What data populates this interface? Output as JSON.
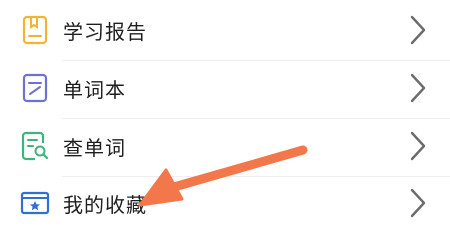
{
  "menu": {
    "items": [
      {
        "label": "学习报告",
        "icon": "report-icon",
        "color": "#f2b531"
      },
      {
        "label": "单词本",
        "icon": "wordbook-icon",
        "color": "#6f70d6"
      },
      {
        "label": "查单词",
        "icon": "search-word-icon",
        "color": "#3fb37a"
      },
      {
        "label": "我的收藏",
        "icon": "favorites-icon",
        "color": "#2f6fd6"
      }
    ],
    "chevron_icon": "chevron-right-icon",
    "chevron_color": "#6b6b6b"
  },
  "annotation": {
    "icon": "pointer-arrow",
    "color": "#f2784b"
  }
}
